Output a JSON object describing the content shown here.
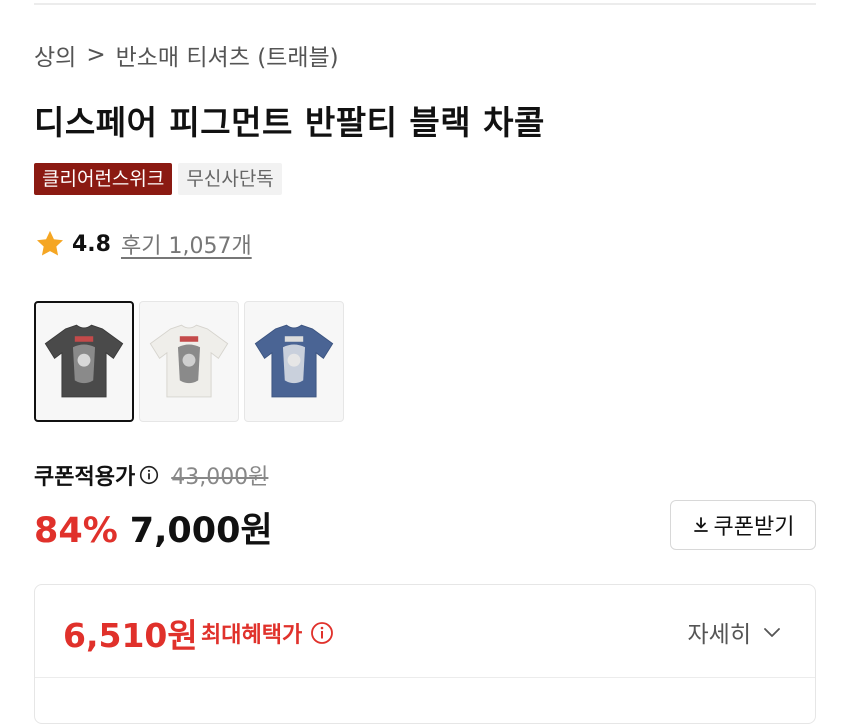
{
  "breadcrumb": {
    "category": "상의",
    "separator": ">",
    "subcategory": "반소매 티셔츠 (트래블)"
  },
  "product": {
    "title": "디스페어 피그먼트 반팔티 블랙 차콜",
    "badges": [
      "클리어런스위크",
      "무신사단독"
    ],
    "rating": "4.8",
    "reviews": "후기 1,057개"
  },
  "thumbnails": [
    {
      "name": "black-tee",
      "color": "#4a4a4a"
    },
    {
      "name": "white-tee",
      "color": "#efeeea"
    },
    {
      "name": "blue-tee",
      "color": "#4a6494"
    }
  ],
  "price": {
    "coupon_label": "쿠폰적용가",
    "original": "43,000원",
    "discount": "84%",
    "sale": "7,000원",
    "coupon_button": "쿠폰받기"
  },
  "benefit": {
    "price": "6,510원",
    "label": "최대혜택가",
    "detail": "자세히"
  },
  "colors": {
    "accent_red": "#e0312b",
    "badge_red": "#8b1a12",
    "star": "#f5a623"
  }
}
